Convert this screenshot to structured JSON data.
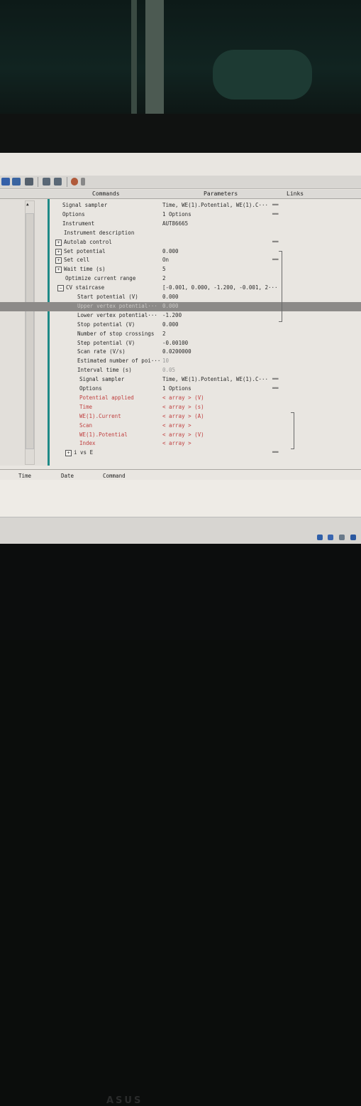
{
  "toolbar": {
    "icons": [
      "save-icon",
      "save-as-icon",
      "indent-icon",
      "undo-icon",
      "redo-icon",
      "settings-icon"
    ]
  },
  "columns": {
    "commands": "Commands",
    "parameters": "Parameters",
    "links": "Links"
  },
  "rows": [
    {
      "name": "Signal sampler",
      "param": "Time, WE(1).Potential, WE(1).C···",
      "link": "══"
    },
    {
      "name": "Options",
      "param": "1 Options",
      "link": "══"
    },
    {
      "name": "Instrument",
      "param": "AUT86665",
      "link": ""
    },
    {
      "name": "Instrument description",
      "param": "",
      "link": ""
    },
    {
      "name": "Autolab control",
      "param": "",
      "link": "══",
      "expander": "+"
    },
    {
      "name": "Set potential",
      "param": "0.000",
      "link": "",
      "expander": "+"
    },
    {
      "name": "Set cell",
      "param": "On",
      "link": "══",
      "expander": "+"
    },
    {
      "name": "Wait time (s)",
      "param": "5",
      "link": "",
      "expander": "+"
    },
    {
      "name": "Optimize current range",
      "param": "2",
      "link": ""
    },
    {
      "name": "CV staircase",
      "param": "[-0.001, 0.000, -1.200, -0.001, 2···",
      "link": "",
      "expander": "−"
    },
    {
      "name": "Start potential (V)",
      "param": "0.000",
      "link": ""
    },
    {
      "name": "Upper vertex potential···",
      "param": "0.000",
      "link": "",
      "selected": true
    },
    {
      "name": "Lower vertex potential···",
      "param": "-1.200",
      "link": ""
    },
    {
      "name": "Stop potential (V)",
      "param": "0.000",
      "link": ""
    },
    {
      "name": "Number of stop crossings",
      "param": "2",
      "link": ""
    },
    {
      "name": "Step potential (V)",
      "param": "-0.00100",
      "link": ""
    },
    {
      "name": "Scan rate (V/s)",
      "param": "0.0200000",
      "link": ""
    },
    {
      "name": "Estimated number of poi···",
      "param": "10",
      "link": "",
      "greyParam": true
    },
    {
      "name": "Interval time (s)",
      "param": "0.05",
      "link": "",
      "greyParam": true
    },
    {
      "name": "Signal sampler",
      "param": "Time, WE(1).Potential, WE(1).C···",
      "link": "══"
    },
    {
      "name": "Options",
      "param": "1 Options",
      "link": "══"
    },
    {
      "name": "Potential applied",
      "param": "< array > (V)",
      "link": "",
      "red": true
    },
    {
      "name": "Time",
      "param": "< array > (s)",
      "link": "",
      "red": true
    },
    {
      "name": "WE(1).Current",
      "param": "< array > (A)",
      "link": "",
      "red": true
    },
    {
      "name": "Scan",
      "param": "< array >",
      "link": "",
      "red": true
    },
    {
      "name": "WE(1).Potential",
      "param": "< array > (V)",
      "link": "",
      "red": true
    },
    {
      "name": "Index",
      "param": "< array >",
      "link": "",
      "red": true
    },
    {
      "name": "i vs E",
      "param": "",
      "link": "══",
      "expander": "+"
    }
  ],
  "log": {
    "time": "Time",
    "date": "Date",
    "command": "Command"
  },
  "bezel": {
    "logo": "ASUS"
  }
}
